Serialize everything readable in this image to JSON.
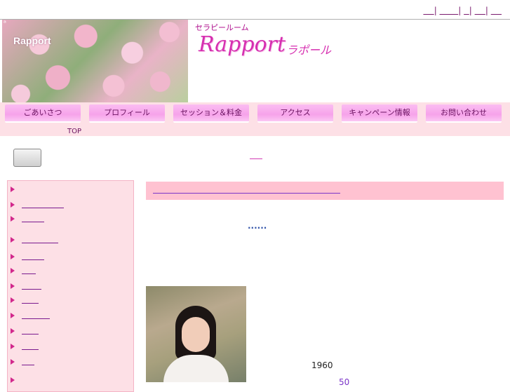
{
  "header": {
    "site_label": "Rapport",
    "subtitle": "セラピールーム",
    "logo": "Rapport",
    "logo_kana": "ラポール"
  },
  "nav": {
    "items": [
      {
        "label": "ごあいさつ"
      },
      {
        "label": "プロフィール"
      },
      {
        "label": "セッション＆料金"
      },
      {
        "label": "アクセス"
      },
      {
        "label": "キャンペーン情報"
      },
      {
        "label": "お問い合わせ"
      }
    ],
    "top_link": "TOP"
  },
  "content": {
    "dots": "......",
    "year": "1960",
    "number": "50"
  }
}
